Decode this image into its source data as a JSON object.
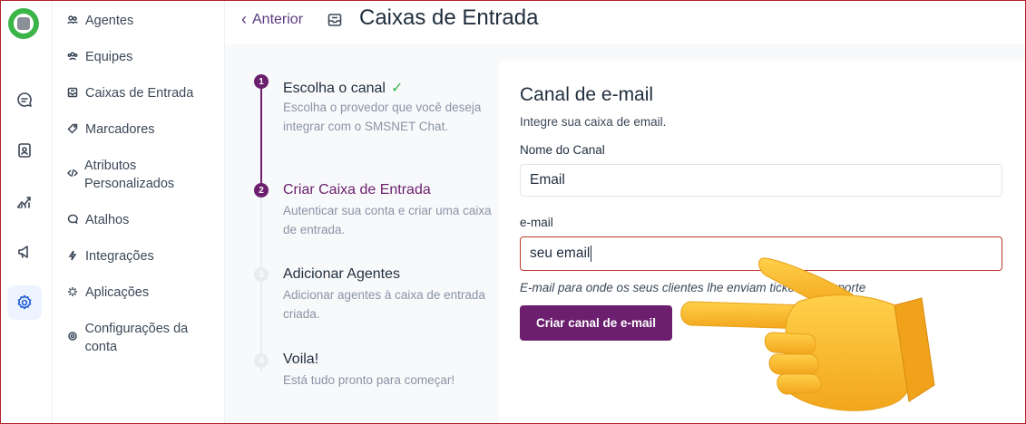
{
  "header": {
    "back_label": "Anterior",
    "title": "Caixas de Entrada"
  },
  "rail": {
    "icons": [
      "app-logo",
      "conversations-icon",
      "contacts-icon",
      "reports-icon",
      "campaigns-icon",
      "settings-icon"
    ]
  },
  "sidebar": {
    "items": [
      {
        "label": "Agentes",
        "icon": "people-icon"
      },
      {
        "label": "Equipes",
        "icon": "team-icon"
      },
      {
        "label": "Caixas de Entrada",
        "icon": "inbox-icon"
      },
      {
        "label": "Marcadores",
        "icon": "tag-icon"
      },
      {
        "label": "Atributos Personalizados",
        "icon": "code-icon"
      },
      {
        "label": "Atalhos",
        "icon": "chat-icon"
      },
      {
        "label": "Integrações",
        "icon": "bolt-icon"
      },
      {
        "label": "Aplicações",
        "icon": "sparkle-icon"
      },
      {
        "label": "Configurações da conta",
        "icon": "gear-icon"
      }
    ]
  },
  "steps": [
    {
      "number": "1",
      "title": "Escolha o canal",
      "description": "Escolha o provedor que você deseja integrar com o SMSNET Chat.",
      "status": "done"
    },
    {
      "number": "2",
      "title": "Criar Caixa de Entrada",
      "description": "Autenticar sua conta e criar uma caixa de entrada.",
      "status": "current"
    },
    {
      "number": "3",
      "title": "Adicionar Agentes",
      "description": "Adicionar agentes à caixa de entrada criada.",
      "status": "pending"
    },
    {
      "number": "4",
      "title": "Voila!",
      "description": "Está tudo pronto para começar!",
      "status": "pending"
    }
  ],
  "form": {
    "title": "Canal de e-mail",
    "subtitle": "Integre sua caixa de email.",
    "channel_name_label": "Nome do Canal",
    "channel_name_value": "Email",
    "email_label": "e-mail",
    "email_value": "seu email",
    "email_help": "E-mail para onde os seus clientes lhe enviam tickets de suporte",
    "submit_label": "Criar canal de e-mail"
  },
  "colors": {
    "accent": "#6b1f6e",
    "accent_text": "#5b3a7d",
    "logo_green": "#3bb54a",
    "error": "#c0392b"
  }
}
